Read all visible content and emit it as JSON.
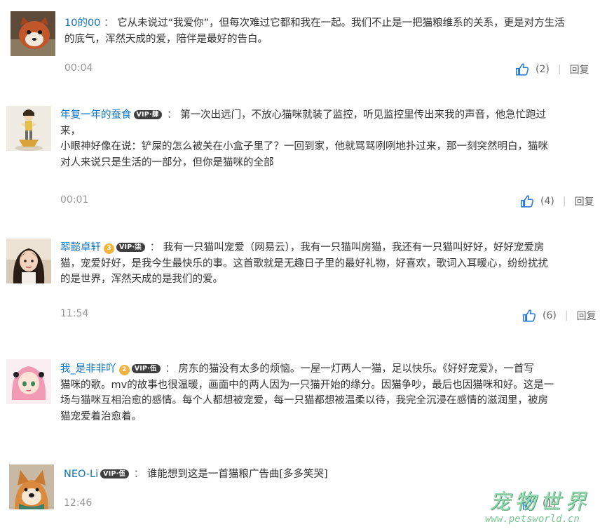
{
  "colors": {
    "username": "#0c73c2",
    "text": "#333333",
    "meta": "#999999",
    "like_icon": "#2a7ad6"
  },
  "comments": [
    {
      "avatar": "red-panda-photo",
      "user": "10的00",
      "line1": "它从未说过“我爱你”，但每次难过它都和我在一起。我们不止是一把猫粮维系的关系，更是对方生活",
      "line2": "的底气，浑然天成的爱，陪伴是最好的告白。",
      "time": "00:04",
      "likes": "(2)",
      "reply": "回复"
    },
    {
      "avatar": "cartoon-girl-figure",
      "user": "年复一年的蚕食",
      "badge": "VIP·肆",
      "line1": "第一次出远门，不放心猫咪就装了监控，听见监控里传出来我的声音，他急忙跑过",
      "line2": "来，",
      "line3": "小眼神好像在说：铲屎的怎么被关在小盒子里了？一回到家，他就骂骂咧咧地扑过来，那一刻突然明白，猫咪",
      "line4": "对人来说只是生活的一部分，但你是猫咪的全部",
      "time": "00:01",
      "likes": "(4)",
      "reply": "回复"
    },
    {
      "avatar": "woman-portrait-photo",
      "user": "翆懿卓轩",
      "crown": "3",
      "badge": "VIP·柒",
      "line1": "我有一只猫叫宠爱（网易云），我有一只猫叫房猫，我还有一只猫叫好好，好好宠爱房",
      "line2": "猫，宠爱好好，是我今生最快乐的事。这首歌就是无趣日子里的最好礼物，好喜欢，歌词入耳暖心，纷纷扰扰",
      "line3": "的是世界，浑然天成的是我们的爱。",
      "time": "11:54",
      "likes": "(6)",
      "reply": "回复"
    },
    {
      "avatar": "anime-pink-hair-girl",
      "user": "我_是非非吖",
      "crown": "2",
      "badge": "VIP·伍",
      "line1": "房东的猫没有太多的烦恼。一屋一灯两人一猫，足以快乐。《好好宠爱》，一首写",
      "line2": "猫咪的歌。mv的故事也很温暖，画面中的两人因为一只猫开始的缘分。因猫争吵，最后也因猫咪和好。这是一",
      "line3": "场与猫咪互相治愈的感情。每个人都想被宠爱，每一只猫都想被温柔以待，我完全沉浸在感情的滋润里，被房",
      "line4": "猫宠爱着治愈着。"
    },
    {
      "avatar": "shiba-dog-photo",
      "user": "NEO-Li",
      "badge": "VIP·伍",
      "line1": "谁能想到这是一首猫粮广告曲[多多笑哭]",
      "time": "12:46",
      "likes": "(1)"
    }
  ],
  "watermark": {
    "title": "宠物世界",
    "url": "www.petsworld.cn"
  }
}
